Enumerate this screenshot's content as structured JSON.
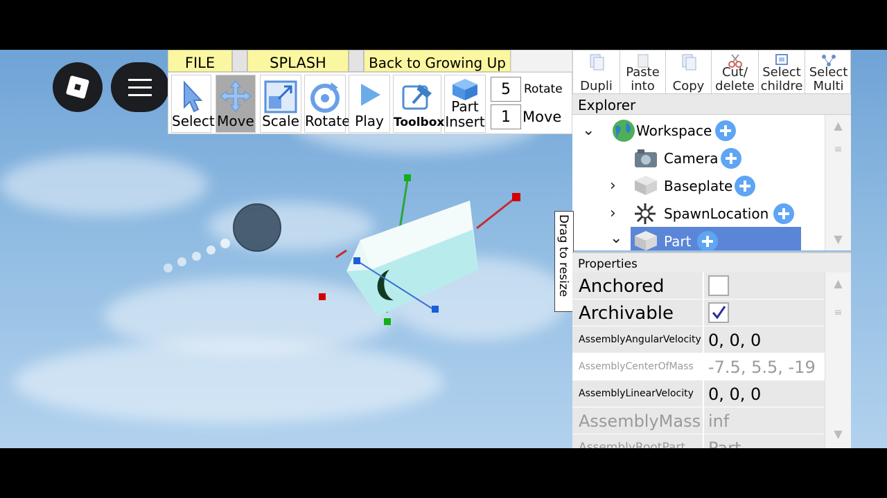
{
  "toolbar": {
    "tabs": [
      "FILE",
      "SPLASH",
      "Back to Growing Up"
    ],
    "tools": [
      "Select",
      "Move",
      "Scale",
      "Rotate",
      "Play",
      "Toolbox",
      "Part\nInsert"
    ],
    "rotate_step": "5",
    "rotate_label": "Rotate",
    "move_step": "1",
    "move_label": "Move"
  },
  "edit_buttons": [
    "Dupli",
    "Paste\ninto",
    "Copy",
    "Cut/\ndelete",
    "Select\nchildre",
    "Select\nMulti"
  ],
  "explorer": {
    "title": "Explorer",
    "items": [
      {
        "name": "Workspace",
        "icon": "globe-icon",
        "expanded": true
      },
      {
        "name": "Camera",
        "icon": "camera-icon"
      },
      {
        "name": "Baseplate",
        "icon": "part-icon",
        "collapsed": true
      },
      {
        "name": "SpawnLocation",
        "icon": "spawn-icon",
        "collapsed": true
      },
      {
        "name": "Part",
        "icon": "part-icon",
        "expanded": true,
        "selected": true
      }
    ]
  },
  "drag_label": "Drag to resize",
  "properties": {
    "title": "Properties",
    "rows": [
      {
        "name": "Anchored",
        "value": "",
        "checkbox": false
      },
      {
        "name": "Archivable",
        "value": "",
        "checkbox": true
      },
      {
        "name": "AssemblyAngularVelocity",
        "value": "0, 0, 0"
      },
      {
        "name": "AssemblyCenterOfMass",
        "value": "-7.5, 5.5, -19"
      },
      {
        "name": "AssemblyLinearVelocity",
        "value": "0, 0, 0"
      },
      {
        "name": "AssemblyMass",
        "value": "inf"
      },
      {
        "name": "AssemblyRootPart",
        "value": "Part"
      }
    ]
  },
  "colors": {
    "selection": "#5b86d8",
    "tab_yellow": "#fbf7a0",
    "plus_blue": "#5ea5f4"
  }
}
